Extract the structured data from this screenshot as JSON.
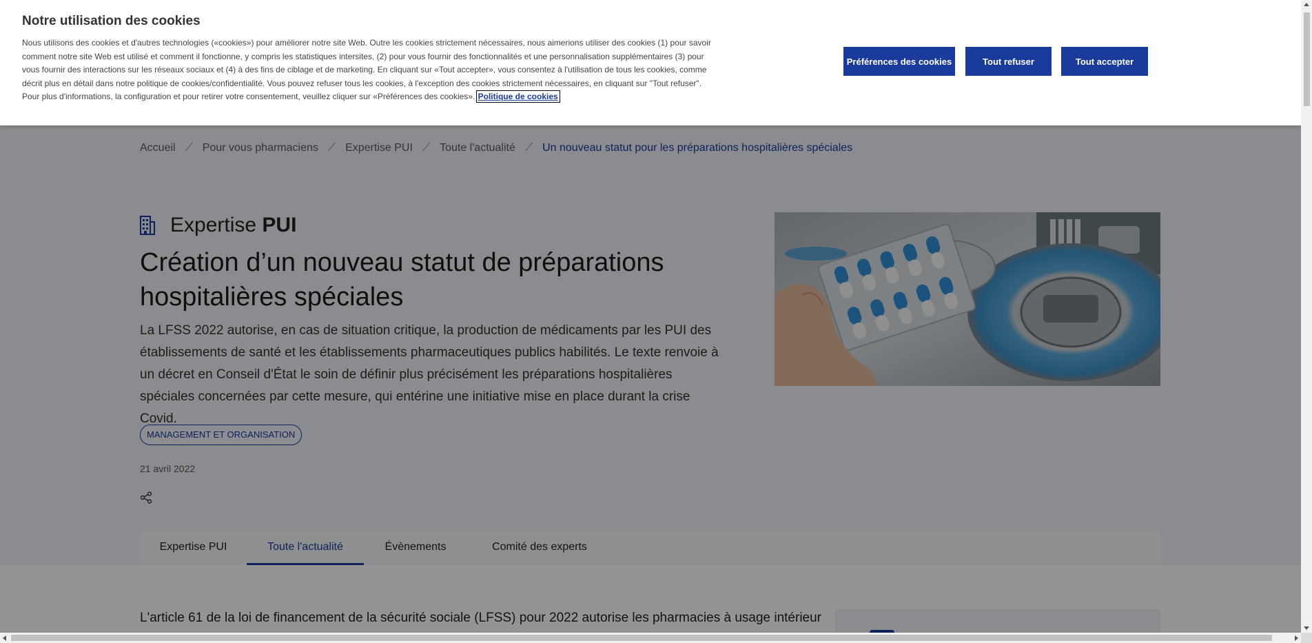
{
  "cookie_banner": {
    "title": "Notre utilisation des cookies",
    "body": "Nous utilisons des cookies et d'autres technologies («cookies») pour améliorer notre site Web. Outre les cookies strictement nécessaires, nous aimerions utiliser des cookies (1) pour savoir comment notre site Web est utilisé et comment il fonctionne, y compris les statistiques intersites, (2) pour vous fournir des fonctionnalités et une personnalisation supplémentaires (3) pour vous fournir des interactions sur les réseaux sociaux et (4) à des fins de ciblage et de marketing. En cliquant sur «Tout accepter», vous consentez à l'utilisation de tous les cookies, comme décrit plus en détail dans notre politique de cookies/confidentialité. Vous pouvez refuser tous les cookies, à l'exception des cookies strictement nécessaires, en cliquant sur \"Tout refuser\". Pour plus d'informations, la configuration et pour retirer votre consentement, veuillez cliquer sur «Préférences des cookies».",
    "policy_link": "Politique de cookies",
    "preferences_button": "Préférences des cookies",
    "reject_button": "Tout refuser",
    "accept_button": "Tout accepter",
    "button_color": "#1a3a9c"
  },
  "breadcrumb": {
    "items": [
      "Accueil",
      "Pour vous pharmaciens",
      "Expertise PUI",
      "Toute l'actualité"
    ],
    "current": "Un nouveau statut pour les préparations hospitalières spéciales",
    "separator": "⟋"
  },
  "category": {
    "icon": "hospital-building-icon",
    "label_light": "Expertise",
    "label_bold": "PUI"
  },
  "article": {
    "title": "Création d’un nouveau statut de préparations hospitalières spéciales",
    "lead": "La LFSS 2022 autorise, en cas de situation critique, la production de médicaments par les PUI des établissements de santé et les établissements pharmaceutiques publics habilités. Le texte renvoie à un décret en Conseil d'État le soin de définir plus précisément les préparations hospitalières spéciales concernées par cette mesure, qui entérine une initiative mise en place durant la crise Covid.",
    "tag": "MANAGEMENT ET ORGANISATION",
    "date": "21 avril 2022",
    "share_icon": "share-icon",
    "body_start": "L'article 61 de la loi de financement de la sécurité sociale (LFSS) pour 2022 autorise les pharmacies à usage intérieur"
  },
  "tabs": [
    {
      "label": "Expertise PUI",
      "active": false
    },
    {
      "label": "Toute l'actualité",
      "active": true
    },
    {
      "label": "Évènements",
      "active": false
    },
    {
      "label": "Comité des experts",
      "active": false
    }
  ],
  "colors": {
    "accent": "#1a3a9c",
    "overlay": "rgba(0,0,0,0.42)"
  }
}
